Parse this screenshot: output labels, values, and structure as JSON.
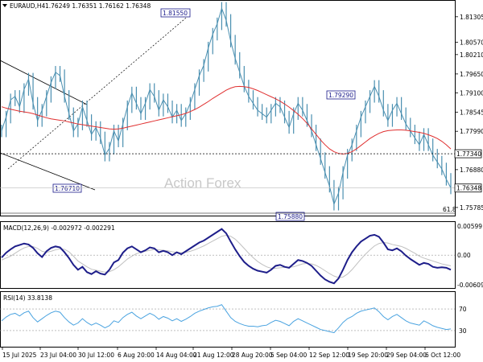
{
  "header": {
    "symbol": "EURAUD,H4",
    "ohlc": "1.76249 1.76351 1.76162 1.76348",
    "macd_label": "MACD(12,26,9) -0.002972 -0.002291",
    "rsi_label": "RSI(14) 33.8138"
  },
  "watermark": "Action Forex",
  "price_axis": {
    "ticks": [
      "1.81305",
      "1.80570",
      "1.80210",
      "1.79650",
      "1.79100",
      "1.78545",
      "1.77990",
      "1.76880",
      "1.75785"
    ],
    "ylim": [
      1.7555,
      1.8165
    ]
  },
  "macd_axis": {
    "ticks": [
      "0.00599",
      "0.00",
      "-0.006095"
    ],
    "ylim": [
      -0.0066,
      0.0065
    ]
  },
  "rsi_axis": {
    "ticks": [
      "70",
      "30"
    ],
    "ylim": [
      0,
      100
    ]
  },
  "x_labels": [
    "15 Jul 2025",
    "23 Jul 04:00",
    "30 Jul 12:00",
    "6 Aug 20:00",
    "14 Aug 04:00",
    "21 Aug 12:00",
    "28 Aug 20:00",
    "5 Sep 04:00",
    "12 Sep 12:00",
    "19 Sep 20:00",
    "29 Sep 04:00",
    "6 Oct 12:00"
  ],
  "annotations": {
    "high1": "1.81550",
    "low1": "1.76710",
    "low2": "1.75880",
    "high2": "1.79290",
    "level_label": "1.77340",
    "current_label": "1.76348",
    "fib_label": "61.8"
  },
  "colors": {
    "price": "#4a8fb0",
    "ma": "#e03030",
    "macd": "#1e1e8a",
    "signal": "#c0c0c0",
    "rsi": "#4aa3e0",
    "box_border": "#1a1a8a"
  },
  "chart_data": [
    {
      "type": "line",
      "title": "EURAUD,H4",
      "series": [
        {
          "name": "EURAUD,H4",
          "values": [
            1.78,
            1.784,
            1.789,
            1.79,
            1.787,
            1.792,
            1.795,
            1.788,
            1.783,
            1.786,
            1.79,
            1.794,
            1.797,
            1.796,
            1.79,
            1.785,
            1.78,
            1.782,
            1.787,
            1.783,
            1.779,
            1.781,
            1.778,
            1.773,
            1.775,
            1.78,
            1.7771,
            1.782,
            1.787,
            1.791,
            1.788,
            1.785,
            1.788,
            1.792,
            1.79,
            1.786,
            1.789,
            1.787,
            1.784,
            1.786,
            1.783,
            1.785,
            1.788,
            1.792,
            1.796,
            1.799,
            1.804,
            1.808,
            1.811,
            1.8155,
            1.812,
            1.806,
            1.801,
            1.797,
            1.793,
            1.79,
            1.788,
            1.786,
            1.785,
            1.784,
            1.786,
            1.788,
            1.787,
            1.784,
            1.781,
            1.785,
            1.788,
            1.786,
            1.783,
            1.78,
            1.776,
            1.772,
            1.768,
            1.764,
            1.7588,
            1.762,
            1.768,
            1.773,
            1.776,
            1.78,
            1.784,
            1.787,
            1.79,
            1.7929,
            1.79,
            1.786,
            1.783,
            1.786,
            1.788,
            1.785,
            1.782,
            1.78,
            1.778,
            1.776,
            1.779,
            1.776,
            1.773,
            1.771,
            1.769,
            1.766,
            1.7635
          ]
        },
        {
          "name": "MA",
          "values": [
            1.787,
            1.7866,
            1.7863,
            1.786,
            1.7857,
            1.7855,
            1.7853,
            1.785,
            1.7846,
            1.7842,
            1.7838,
            1.7835,
            1.7833,
            1.7831,
            1.7829,
            1.7826,
            1.7823,
            1.782,
            1.7818,
            1.7816,
            1.7814,
            1.7812,
            1.781,
            1.7808,
            1.7806,
            1.7805,
            1.7806,
            1.7808,
            1.7811,
            1.7814,
            1.7817,
            1.782,
            1.7823,
            1.7826,
            1.7829,
            1.7832,
            1.7835,
            1.7838,
            1.7841,
            1.7844,
            1.7847,
            1.7851,
            1.7856,
            1.7862,
            1.7869,
            1.7877,
            1.7885,
            1.7894,
            1.7902,
            1.791,
            1.7918,
            1.7924,
            1.7928,
            1.7929,
            1.7928,
            1.7926,
            1.7922,
            1.7917,
            1.7911,
            1.7905,
            1.7899,
            1.7893,
            1.7886,
            1.7878,
            1.7869,
            1.7859,
            1.7848,
            1.7836,
            1.7822,
            1.7806,
            1.779,
            1.7774,
            1.776,
            1.7748,
            1.774,
            1.7735,
            1.7733,
            1.7735,
            1.774,
            1.7748,
            1.7758,
            1.7768,
            1.7778,
            1.7786,
            1.7793,
            1.7798,
            1.7801,
            1.7802,
            1.7803,
            1.7803,
            1.7802,
            1.78,
            1.7798,
            1.7796,
            1.7793,
            1.7789,
            1.7784,
            1.7778,
            1.777,
            1.776,
            1.7748
          ]
        }
      ]
    },
    {
      "type": "line",
      "title": "MACD(12,26,9)",
      "ylim": [
        -0.0066,
        0.0065
      ],
      "series": [
        {
          "name": "MACD",
          "values": [
            -0.0005,
            0.0005,
            0.0012,
            0.0018,
            0.0021,
            0.0024,
            0.0022,
            0.0015,
            0.0004,
            -0.0004,
            0.0008,
            0.0015,
            0.0018,
            0.0016,
            0.0006,
            -0.0006,
            -0.002,
            -0.003,
            -0.0024,
            -0.0035,
            -0.0039,
            -0.0033,
            -0.0038,
            -0.004,
            -0.003,
            -0.0015,
            -0.001,
            0.0005,
            0.0014,
            0.0018,
            0.0012,
            0.0006,
            0.001,
            0.0016,
            0.0014,
            0.0006,
            0.0009,
            0.0006,
            0.0,
            0.0006,
            0.0002,
            0.0008,
            0.0014,
            0.002,
            0.0026,
            0.003,
            0.0036,
            0.0042,
            0.0048,
            0.0054,
            0.0045,
            0.0028,
            0.0012,
            -0.0002,
            -0.0014,
            -0.0022,
            -0.0028,
            -0.0032,
            -0.0034,
            -0.0036,
            -0.003,
            -0.0022,
            -0.002,
            -0.0024,
            -0.0026,
            -0.0018,
            -0.001,
            -0.0012,
            -0.0016,
            -0.0022,
            -0.0032,
            -0.0042,
            -0.005,
            -0.0055,
            -0.0058,
            -0.0048,
            -0.003,
            -0.001,
            0.0006,
            0.0018,
            0.0028,
            0.0034,
            0.004,
            0.0042,
            0.0038,
            0.0026,
            0.0012,
            0.001,
            0.0014,
            0.0008,
            -0.0001,
            -0.0008,
            -0.0014,
            -0.002,
            -0.0016,
            -0.0018,
            -0.0024,
            -0.0026,
            -0.0025,
            -0.0026,
            -0.003
          ]
        },
        {
          "name": "Signal",
          "values": [
            -0.001,
            -0.0006,
            -0.0002,
            0.0004,
            0.001,
            0.0015,
            0.0018,
            0.0018,
            0.0014,
            0.0008,
            0.0006,
            0.0008,
            0.0011,
            0.0013,
            0.0012,
            0.0007,
            -0.0002,
            -0.0012,
            -0.0018,
            -0.0024,
            -0.0029,
            -0.0031,
            -0.0033,
            -0.0035,
            -0.0034,
            -0.003,
            -0.0024,
            -0.0016,
            -0.0008,
            -0.0002,
            0.0003,
            0.0006,
            0.0008,
            0.001,
            0.0012,
            0.0011,
            0.001,
            0.0009,
            0.0007,
            0.0006,
            0.0005,
            0.0006,
            0.0008,
            0.0011,
            0.0015,
            0.0019,
            0.0024,
            0.0029,
            0.0034,
            0.0039,
            0.0041,
            0.0039,
            0.0033,
            0.0024,
            0.0014,
            0.0004,
            -0.0005,
            -0.0013,
            -0.0019,
            -0.0024,
            -0.0027,
            -0.0027,
            -0.0026,
            -0.0025,
            -0.0025,
            -0.0024,
            -0.0021,
            -0.0018,
            -0.0017,
            -0.0018,
            -0.0021,
            -0.0026,
            -0.0032,
            -0.0038,
            -0.0043,
            -0.0046,
            -0.0045,
            -0.0039,
            -0.003,
            -0.0019,
            -0.0008,
            0.0002,
            0.0011,
            0.0019,
            0.0024,
            0.0026,
            0.0025,
            0.0022,
            0.002,
            0.0018,
            0.0014,
            0.0009,
            0.0004,
            -0.0002,
            -0.0006,
            -0.0009,
            -0.0012,
            -0.0015,
            -0.0018,
            -0.002,
            -0.0022
          ]
        }
      ]
    },
    {
      "type": "line",
      "title": "RSI(14)",
      "ylim": [
        0,
        100
      ],
      "series": [
        {
          "name": "RSI(14)",
          "values": [
            48,
            55,
            60,
            62,
            57,
            63,
            66,
            54,
            46,
            52,
            58,
            63,
            66,
            64,
            54,
            46,
            40,
            44,
            52,
            45,
            40,
            44,
            40,
            35,
            39,
            48,
            45,
            54,
            60,
            64,
            57,
            52,
            57,
            62,
            58,
            51,
            56,
            53,
            48,
            52,
            47,
            51,
            56,
            62,
            66,
            69,
            72,
            74,
            75,
            78,
            66,
            54,
            47,
            43,
            40,
            38,
            38,
            37,
            39,
            40,
            45,
            49,
            47,
            43,
            39,
            47,
            52,
            48,
            44,
            40,
            36,
            32,
            30,
            28,
            26,
            35,
            45,
            52,
            56,
            62,
            66,
            68,
            70,
            72,
            65,
            56,
            50,
            56,
            60,
            54,
            48,
            44,
            42,
            40,
            48,
            44,
            39,
            36,
            34,
            32,
            33
          ]
        }
      ]
    }
  ]
}
